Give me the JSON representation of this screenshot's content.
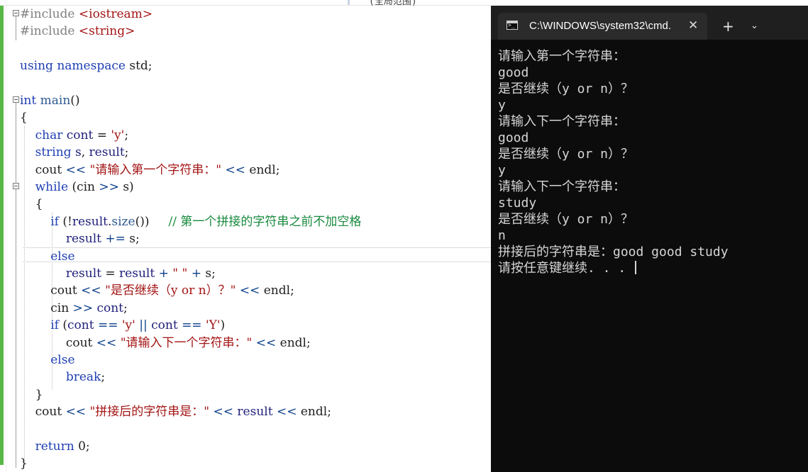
{
  "editor": {
    "tab_fragment": "(全局范围)",
    "lines": [
      [
        {
          "c": "pp",
          "t": "#include "
        },
        {
          "c": "str",
          "t": "<iostream>"
        }
      ],
      [
        {
          "c": "pp",
          "t": "#include "
        },
        {
          "c": "str",
          "t": "<string>"
        }
      ],
      [],
      [
        {
          "c": "kw",
          "t": "using namespace "
        },
        {
          "c": "plain",
          "t": "std;"
        }
      ],
      [],
      [
        {
          "c": "kw",
          "t": "int "
        },
        {
          "c": "fn",
          "t": "main"
        },
        {
          "c": "plain",
          "t": "()"
        }
      ],
      [
        {
          "c": "plain",
          "t": "{"
        }
      ],
      [
        {
          "c": "kw",
          "t": "    char "
        },
        {
          "c": "var",
          "t": "cont"
        },
        {
          "c": "plain",
          "t": " = "
        },
        {
          "c": "str",
          "t": "'y'"
        },
        {
          "c": "plain",
          "t": ";"
        }
      ],
      [
        {
          "c": "kw",
          "t": "    string "
        },
        {
          "c": "var",
          "t": "s"
        },
        {
          "c": "plain",
          "t": ", "
        },
        {
          "c": "var",
          "t": "result"
        },
        {
          "c": "plain",
          "t": ";"
        }
      ],
      [
        {
          "c": "plain",
          "t": "    cout "
        },
        {
          "c": "op",
          "t": "<<"
        },
        {
          "c": "str",
          "t": " \"请输入第一个字符串：\" "
        },
        {
          "c": "op",
          "t": "<<"
        },
        {
          "c": "plain",
          "t": " endl;"
        }
      ],
      [
        {
          "c": "kw",
          "t": "    while "
        },
        {
          "c": "plain",
          "t": "(cin "
        },
        {
          "c": "op",
          "t": ">>"
        },
        {
          "c": "plain",
          "t": " s)"
        }
      ],
      [
        {
          "c": "plain",
          "t": "    {"
        }
      ],
      [
        {
          "c": "kw",
          "t": "        if "
        },
        {
          "c": "plain",
          "t": "(!"
        },
        {
          "c": "var",
          "t": "result"
        },
        {
          "c": "plain",
          "t": "."
        },
        {
          "c": "fn",
          "t": "size"
        },
        {
          "c": "plain",
          "t": "())     "
        },
        {
          "c": "cmt",
          "t": "// 第一个拼接的字符串之前不加空格"
        }
      ],
      [
        {
          "c": "var",
          "t": "            result"
        },
        {
          "c": "plain",
          "t": " "
        },
        {
          "c": "op",
          "t": "+="
        },
        {
          "c": "plain",
          "t": " s;"
        }
      ],
      [
        {
          "c": "kw",
          "t": "        else"
        }
      ],
      [
        {
          "c": "var",
          "t": "            result"
        },
        {
          "c": "plain",
          "t": " = "
        },
        {
          "c": "var",
          "t": "result"
        },
        {
          "c": "plain",
          "t": " "
        },
        {
          "c": "op",
          "t": "+"
        },
        {
          "c": "str",
          "t": " \" \" "
        },
        {
          "c": "op",
          "t": "+"
        },
        {
          "c": "plain",
          "t": " s;"
        }
      ],
      [
        {
          "c": "plain",
          "t": "        cout "
        },
        {
          "c": "op",
          "t": "<<"
        },
        {
          "c": "str",
          "t": " \"是否继续（y or n）？\" "
        },
        {
          "c": "op",
          "t": "<<"
        },
        {
          "c": "plain",
          "t": " endl;"
        }
      ],
      [
        {
          "c": "plain",
          "t": "        cin "
        },
        {
          "c": "op",
          "t": ">>"
        },
        {
          "c": "plain",
          "t": " "
        },
        {
          "c": "var",
          "t": "cont"
        },
        {
          "c": "plain",
          "t": ";"
        }
      ],
      [
        {
          "c": "kw",
          "t": "        if "
        },
        {
          "c": "plain",
          "t": "("
        },
        {
          "c": "var",
          "t": "cont"
        },
        {
          "c": "plain",
          "t": " "
        },
        {
          "c": "op",
          "t": "=="
        },
        {
          "c": "plain",
          "t": " "
        },
        {
          "c": "str",
          "t": "'y'"
        },
        {
          "c": "plain",
          "t": " "
        },
        {
          "c": "op",
          "t": "||"
        },
        {
          "c": "plain",
          "t": " "
        },
        {
          "c": "var",
          "t": "cont"
        },
        {
          "c": "plain",
          "t": " "
        },
        {
          "c": "op",
          "t": "=="
        },
        {
          "c": "plain",
          "t": " "
        },
        {
          "c": "str",
          "t": "'Y'"
        },
        {
          "c": "plain",
          "t": ")"
        }
      ],
      [
        {
          "c": "plain",
          "t": "            cout "
        },
        {
          "c": "op",
          "t": "<<"
        },
        {
          "c": "str",
          "t": " \"请输入下一个字符串：\" "
        },
        {
          "c": "op",
          "t": "<<"
        },
        {
          "c": "plain",
          "t": " endl;"
        }
      ],
      [
        {
          "c": "kw",
          "t": "        else"
        }
      ],
      [
        {
          "c": "kw",
          "t": "            break"
        },
        {
          "c": "plain",
          "t": ";"
        }
      ],
      [
        {
          "c": "plain",
          "t": "    }"
        }
      ],
      [
        {
          "c": "plain",
          "t": "    cout "
        },
        {
          "c": "op",
          "t": "<<"
        },
        {
          "c": "str",
          "t": " \"拼接后的字符串是：\" "
        },
        {
          "c": "op",
          "t": "<<"
        },
        {
          "c": "plain",
          "t": " "
        },
        {
          "c": "var",
          "t": "result"
        },
        {
          "c": "plain",
          "t": " "
        },
        {
          "c": "op",
          "t": "<<"
        },
        {
          "c": "plain",
          "t": " endl;"
        }
      ],
      [],
      [
        {
          "c": "kw",
          "t": "    return "
        },
        {
          "c": "plain",
          "t": "0;"
        }
      ],
      [
        {
          "c": "plain",
          "t": "}"
        }
      ]
    ]
  },
  "terminal": {
    "tab_title": "C:\\WINDOWS\\system32\\cmd.",
    "close_glyph": "✕",
    "new_tab_glyph": "+",
    "menu_glyph": "⌄",
    "output": [
      "请输入第一个字符串：",
      "good",
      "是否继续（y or n）？",
      "y",
      "请输入下一个字符串：",
      "good",
      "是否继续（y or n）？",
      "y",
      "请输入下一个字符串：",
      "study",
      "是否继续（y or n）？",
      "n",
      "拼接后的字符串是：good good study",
      "请按任意键继续. . . "
    ]
  },
  "colors": {
    "editor_bg": "#ffffff",
    "keyword": "#1f3fb3",
    "string": "#a31515",
    "comment": "#188a3e",
    "change_bar": "#57b846",
    "terminal_bg": "#0c0c0c",
    "terminal_text": "#d6d6d6"
  }
}
